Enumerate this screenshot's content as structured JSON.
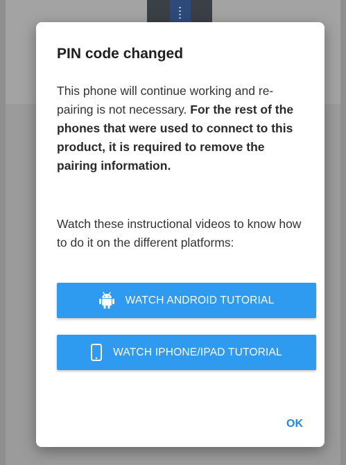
{
  "dialog": {
    "title": "PIN code changed",
    "paragraph1_normal": "This phone will continue working and re-pairing is not necessary.",
    "paragraph1_bold": "For the rest of the phones that were used to connect to this product, it is required to remove the pairing information.",
    "paragraph2": "Watch these instructional videos to know how to do it on the different platforms:",
    "buttons": [
      {
        "label": "WATCH ANDROID TUTORIAL",
        "icon": "android-icon"
      },
      {
        "label": "WATCH IPHONE/IPAD TUTORIAL",
        "icon": "smartphone-icon"
      }
    ],
    "ok_label": "OK"
  },
  "colors": {
    "accent": "#2e9af0",
    "ok_text": "#1e88e5",
    "overlay": "#8f8f8f"
  }
}
